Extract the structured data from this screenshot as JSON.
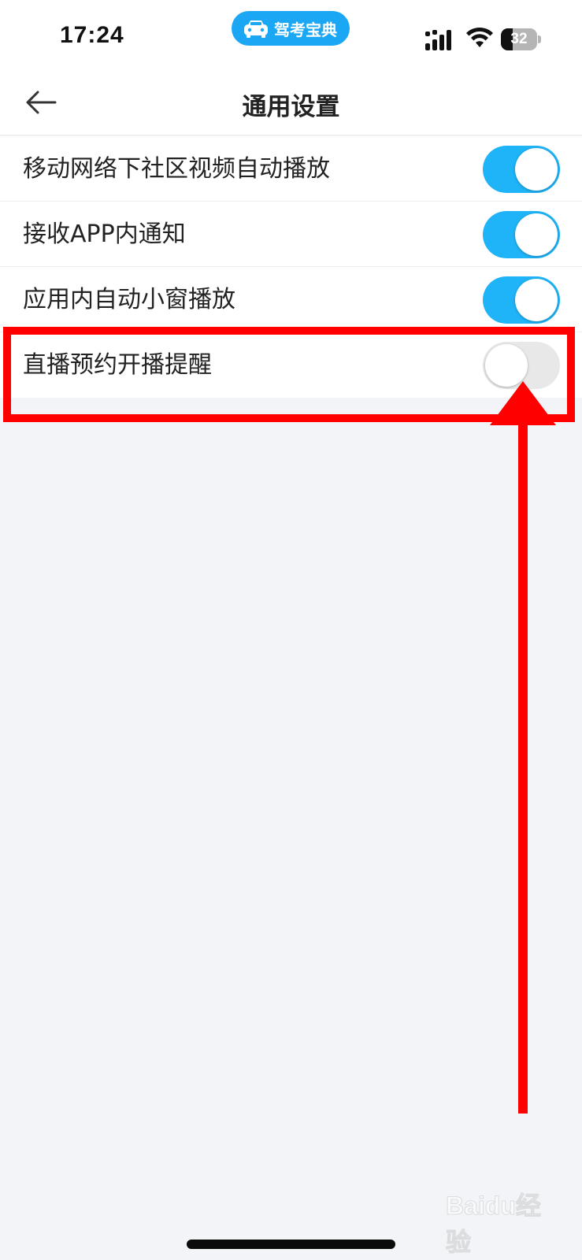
{
  "status_bar": {
    "time": "17:24",
    "app_name": "驾考宝典",
    "battery_percent": "32",
    "battery_level": 0.32,
    "icons": [
      "car-icon",
      "signal-icon",
      "wifi-icon",
      "battery-icon"
    ]
  },
  "nav": {
    "title": "通用设置",
    "back_icon": "back-arrow-icon"
  },
  "settings": [
    {
      "label": "移动网络下社区视频自动播放",
      "enabled": true
    },
    {
      "label": "接收APP内通知",
      "enabled": true
    },
    {
      "label": "应用内自动小窗播放",
      "enabled": true
    },
    {
      "label": "直播预约开播提醒",
      "enabled": false
    }
  ],
  "annotation": {
    "color": "#ff0000",
    "highlighted_row": "直播预约开播提醒"
  },
  "watermark": "Baidu经验",
  "colors": {
    "accent": "#1fb3f7",
    "toggle_off": "#e8e8e8",
    "background": "#f3f4f8"
  }
}
